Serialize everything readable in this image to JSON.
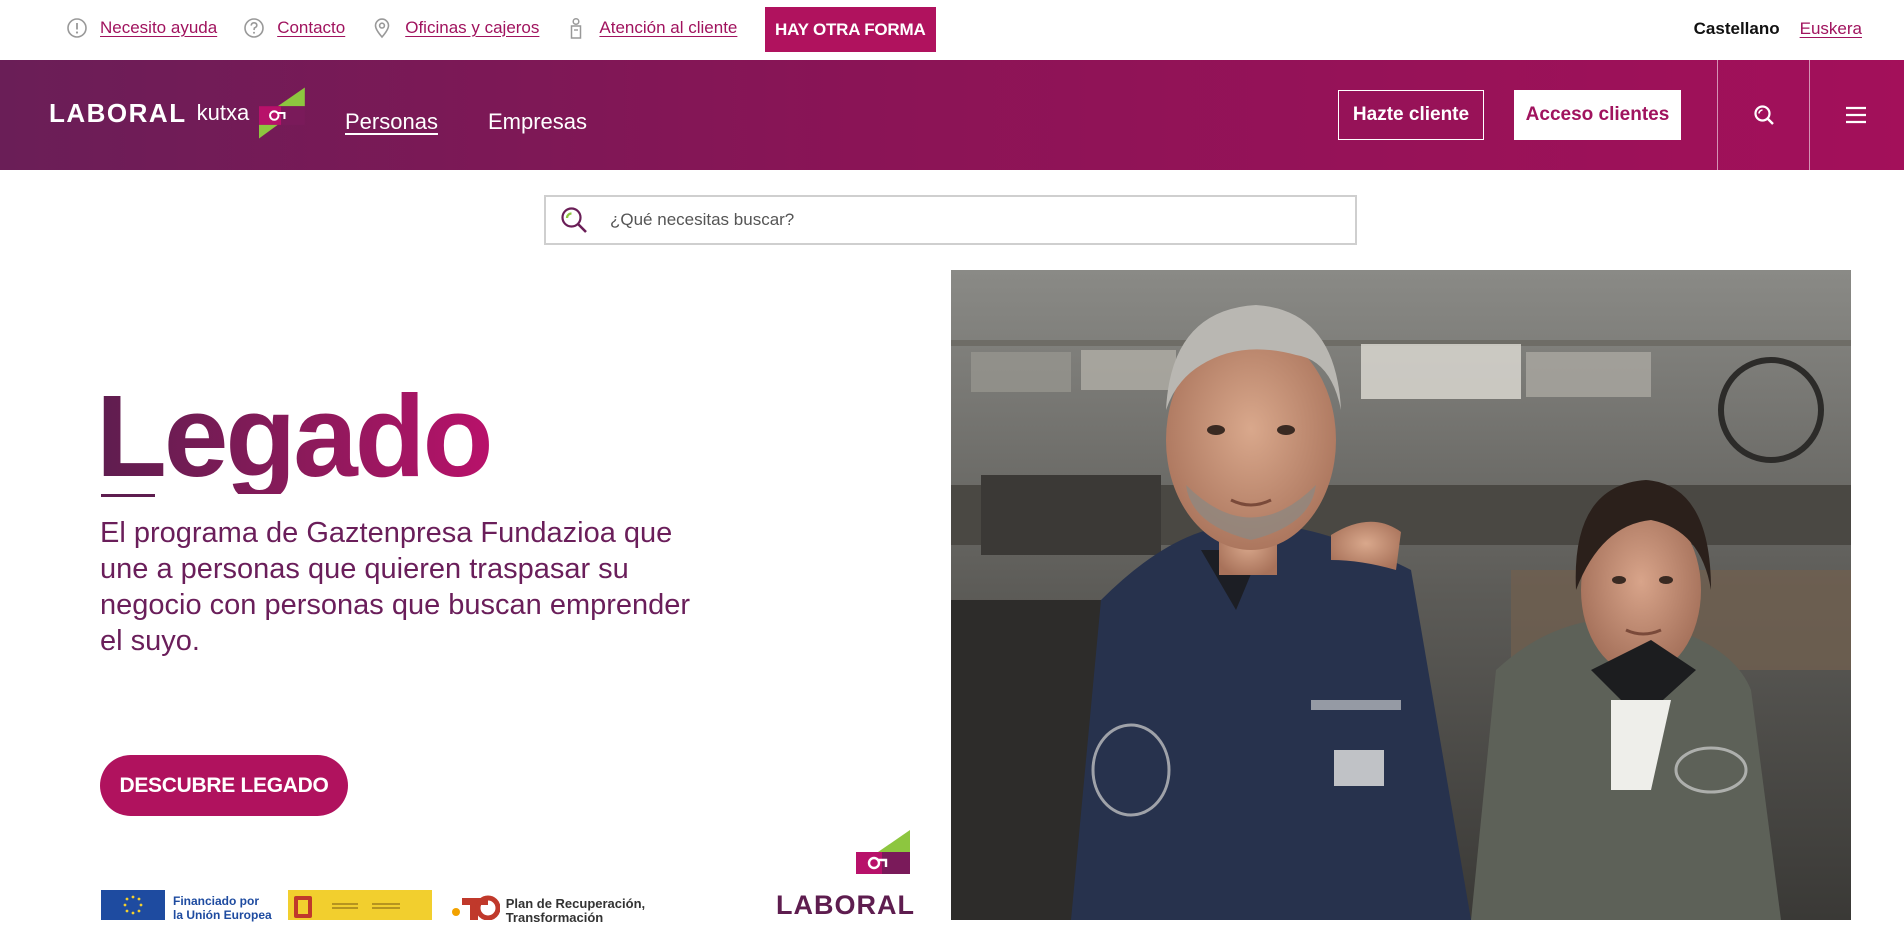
{
  "topbar": {
    "links": [
      {
        "label": "Necesito ayuda",
        "icon": "alert-circle-icon"
      },
      {
        "label": "Contacto",
        "icon": "help-circle-icon"
      },
      {
        "label": "Oficinas y cajeros",
        "icon": "map-pin-icon"
      },
      {
        "label": "Atención al cliente",
        "icon": "person-icon"
      }
    ],
    "promo_button": "HAY OTRA FORMA",
    "languages": {
      "current": "Castellano",
      "alternate": "Euskera"
    }
  },
  "header": {
    "logo": {
      "word1": "LABORAL",
      "word2": "kutxa"
    },
    "nav": [
      {
        "label": "Personas",
        "active": true
      },
      {
        "label": "Empresas",
        "active": false
      }
    ],
    "hazte_cliente": "Hazte cliente",
    "acceso_clientes": "Acceso clientes",
    "search_icon": "search-icon",
    "menu_icon": "hamburger-menu-icon"
  },
  "search": {
    "placeholder": "¿Qué necesitas buscar?",
    "value": ""
  },
  "hero": {
    "title": "Legado",
    "description": "El programa de Gaztenpresa Fundazioa que une a personas que quieren traspasar su negocio con personas que buscan emprender el suyo.",
    "cta": "DESCUBRE LEGADO",
    "funding": {
      "eu_line1": "Financiado por",
      "eu_line2": "la Unión Europea",
      "plan_line1": "Plan de Recuperación,",
      "plan_line2": "Transformación"
    },
    "mini_logo_label": "LABORAL"
  },
  "colors": {
    "brand": "#a0135e",
    "header_start": "#6a1e57",
    "header_end": "#a3105a",
    "accent_green": "#8dc63f"
  }
}
